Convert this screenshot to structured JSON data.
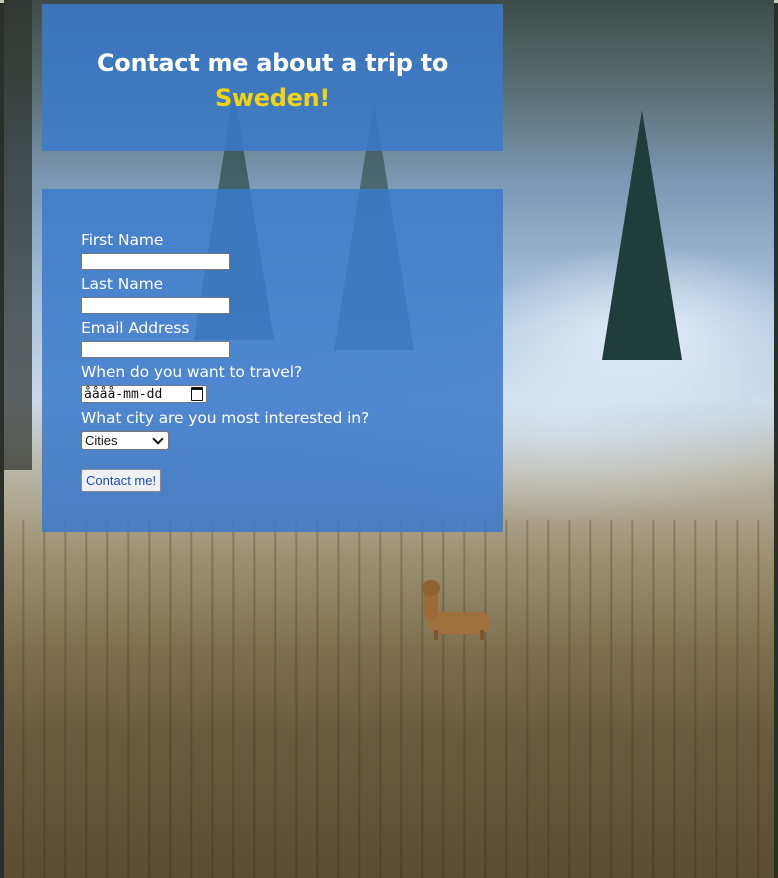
{
  "header": {
    "title_prefix": "Contact me about a trip to",
    "title_accent": "Sweden!"
  },
  "form": {
    "first_name": {
      "label": "First Name",
      "value": ""
    },
    "last_name": {
      "label": "Last Name",
      "value": ""
    },
    "email": {
      "label": "Email Address",
      "value": ""
    },
    "travel_date": {
      "label": "When do you want to travel?",
      "value": "åååå-mm-dd",
      "icon": "calendar-icon"
    },
    "city": {
      "label": "What city are you most interested in?",
      "selected": "Cities",
      "icon": "chevron-down-icon"
    },
    "submit_label": "Contact me!"
  },
  "colors": {
    "panel": "#3a7acc",
    "accent": "#f4d313",
    "text": "#ffffff"
  }
}
